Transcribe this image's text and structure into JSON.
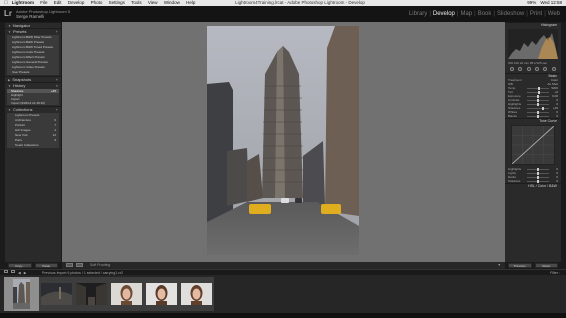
{
  "menubar": {
    "app": "Lightroom",
    "menus": [
      "File",
      "Edit",
      "Develop",
      "Photo",
      "Settings",
      "Tools",
      "View",
      "Window",
      "Help"
    ],
    "window_title": "Lightroom4Training.lrcat - Adobe Photoshop Lightroom - Develop",
    "status_items": [
      "99%",
      "Wed 12:58"
    ]
  },
  "identity": {
    "logo": "Lr",
    "title": "Adobe Photoshop Lightroom 5",
    "user": "Serge Ramelli"
  },
  "modules": [
    {
      "label": "Library",
      "active": false
    },
    {
      "label": "Develop",
      "active": true
    },
    {
      "label": "Map",
      "active": false
    },
    {
      "label": "Book",
      "active": false
    },
    {
      "label": "Slideshow",
      "active": false
    },
    {
      "label": "Print",
      "active": false
    },
    {
      "label": "Web",
      "active": false
    }
  ],
  "left_panel": {
    "navigator": "Navigator",
    "presets": "Presets",
    "preset_items": [
      "Lightroom B&W Filter Presets",
      "Lightroom B&W Presets",
      "Lightroom B&W Toned Presets",
      "Lightroom Color Presets",
      "Lightroom Effect Presets",
      "Lightroom General Presets",
      "Lightroom Video Presets",
      "User Presets"
    ],
    "snapshots": "Snapshots",
    "history": "History",
    "history_items": [
      {
        "label": "Shadows",
        "value": "+45",
        "selected": true
      },
      {
        "label": "Highlight",
        "value": "",
        "selected": false
      },
      {
        "label": "Import",
        "value": "",
        "selected": false
      },
      {
        "label": "Import (9/26/14 21:18:19)",
        "value": "",
        "selected": false
      }
    ],
    "collections": "Collections",
    "collection_items": [
      {
        "label": "Lightroom Presets",
        "count": ""
      },
      {
        "label": "Architecture",
        "count": "6"
      },
      {
        "label": "Portrait",
        "count": "7"
      },
      {
        "label": "Hdr Images",
        "count": "4"
      },
      {
        "label": "New York",
        "count": "12"
      },
      {
        "label": "Paris",
        "count": "9"
      },
      {
        "label": "Smart Collections",
        "count": ""
      }
    ],
    "copy_button": "Copy...",
    "paste_button": "Paste"
  },
  "toolbar": {
    "label": "Soft Proofing"
  },
  "right_panel": {
    "histogram": "Histogram",
    "camera_info": "ISO 100   24 mm   f/8   1/125 sec",
    "sections": [
      {
        "label": "Basic"
      },
      {
        "label": "Tone Curve"
      }
    ],
    "basic_rows": [
      {
        "label": "Treatment",
        "value": "Color"
      },
      {
        "label": "WB",
        "value": "As Shot"
      },
      {
        "label": "Temp",
        "value": "5200"
      },
      {
        "label": "Tint",
        "value": "+6"
      },
      {
        "label": "Exposure",
        "value": "0.00"
      },
      {
        "label": "Contrast",
        "value": "0"
      },
      {
        "label": "Highlights",
        "value": "0"
      },
      {
        "label": "Shadows",
        "value": "+45"
      },
      {
        "label": "Whites",
        "value": "0"
      },
      {
        "label": "Blacks",
        "value": "0"
      }
    ],
    "curve_rows": [
      {
        "label": "Highlights",
        "value": "0"
      },
      {
        "label": "Lights",
        "value": "0"
      },
      {
        "label": "Darks",
        "value": "0"
      },
      {
        "label": "Shadows",
        "value": "0"
      }
    ],
    "hsl": "HSL / Color / B&W",
    "previous_button": "Previous",
    "reset_button": "Reset"
  },
  "filmstrip_bar": {
    "path": "Previous Import     6 photos / 1 selected / carrying1.cr2",
    "filter": "Filter :"
  },
  "filmstrip": {
    "thumbs": [
      {
        "subject": "flatiron-building",
        "selected": true
      },
      {
        "subject": "bridge-night",
        "selected": false
      },
      {
        "subject": "dark-street",
        "selected": false
      },
      {
        "subject": "portrait-woman-1",
        "selected": false
      },
      {
        "subject": "portrait-woman-2",
        "selected": false
      },
      {
        "subject": "portrait-woman-3",
        "selected": false
      }
    ]
  }
}
